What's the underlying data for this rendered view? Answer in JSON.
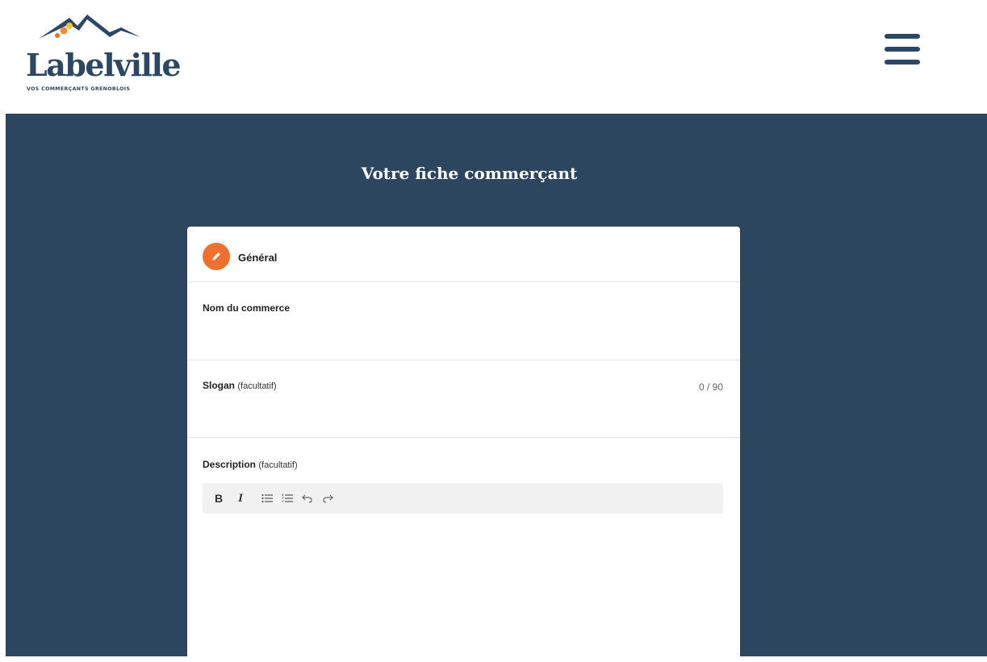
{
  "header": {
    "logo": {
      "name": "Labelville",
      "tagline": "VOS COMMERÇANTS GRENOBLOIS"
    },
    "menu_icon": "hamburger-menu-icon"
  },
  "main": {
    "page_title": "Votre fiche commerçant",
    "section": {
      "icon": "pencil-icon",
      "title": "Général"
    },
    "fields": {
      "name": {
        "label": "Nom du commerce",
        "value": ""
      },
      "slogan": {
        "label": "Slogan",
        "optional": "(facultatif)",
        "value": "",
        "counter": "0 / 90"
      },
      "description": {
        "label": "Description",
        "optional": "(facultatif)",
        "toolbar": {
          "bold": "B",
          "italic": "I",
          "bullet_list": "bullet-list-icon",
          "numbered_list": "numbered-list-icon",
          "undo": "undo-icon",
          "redo": "redo-icon"
        }
      }
    }
  },
  "colors": {
    "navy": "#2d465f",
    "logo_navy": "#2c4763",
    "accent_orange": "#ef6f2d",
    "logo_yellow": "#f6c431",
    "logo_orange": "#f08a3a"
  }
}
